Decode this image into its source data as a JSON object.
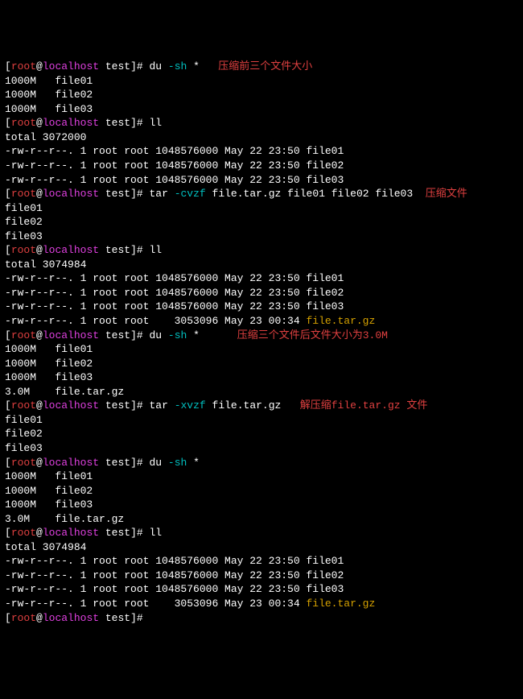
{
  "prompt": {
    "open": "[",
    "user": "root",
    "at": "@",
    "host": "localhost",
    "space": " ",
    "dir": "test",
    "close": "]# "
  },
  "lines": [
    {
      "type": "prompt",
      "cmd": "du ",
      "arg": "-sh",
      "tail": " *",
      "comment": "   压缩前三个文件大小"
    },
    {
      "type": "plain",
      "text": "1000M   file01"
    },
    {
      "type": "plain",
      "text": "1000M   file02"
    },
    {
      "type": "plain",
      "text": "1000M   file03"
    },
    {
      "type": "prompt",
      "cmd": "ll",
      "arg": "",
      "tail": "",
      "comment": ""
    },
    {
      "type": "plain",
      "text": "total 3072000"
    },
    {
      "type": "plain",
      "text": "-rw-r--r--. 1 root root 1048576000 May 22 23:50 file01"
    },
    {
      "type": "plain",
      "text": "-rw-r--r--. 1 root root 1048576000 May 22 23:50 file02"
    },
    {
      "type": "plain",
      "text": "-rw-r--r--. 1 root root 1048576000 May 22 23:50 file03"
    },
    {
      "type": "prompt",
      "cmd": "tar ",
      "arg": "-cvzf",
      "tail": " file.tar.gz file01 file02 file03",
      "comment": "  压缩文件"
    },
    {
      "type": "plain",
      "text": "file01"
    },
    {
      "type": "plain",
      "text": "file02"
    },
    {
      "type": "plain",
      "text": "file03"
    },
    {
      "type": "prompt",
      "cmd": "ll",
      "arg": "",
      "tail": "",
      "comment": ""
    },
    {
      "type": "plain",
      "text": "total 3074984"
    },
    {
      "type": "plain",
      "text": "-rw-r--r--. 1 root root 1048576000 May 22 23:50 file01"
    },
    {
      "type": "plain",
      "text": "-rw-r--r--. 1 root root 1048576000 May 22 23:50 file02"
    },
    {
      "type": "plain",
      "text": "-rw-r--r--. 1 root root 1048576000 May 22 23:50 file03"
    },
    {
      "type": "ls-gold",
      "pre": "-rw-r--r--. 1 root root    3053096 May 23 00:34 ",
      "gold": "file.tar.gz"
    },
    {
      "type": "prompt",
      "cmd": "du ",
      "arg": "-sh",
      "tail": " *",
      "comment": "      压缩三个文件后文件大小为3.0M"
    },
    {
      "type": "plain",
      "text": "1000M   file01"
    },
    {
      "type": "plain",
      "text": "1000M   file02"
    },
    {
      "type": "plain",
      "text": "1000M   file03"
    },
    {
      "type": "plain",
      "text": "3.0M    file.tar.gz"
    },
    {
      "type": "prompt",
      "cmd": "tar ",
      "arg": "-xvzf",
      "tail": " file.tar.gz",
      "comment": "   解压缩file.tar.gz 文件"
    },
    {
      "type": "plain",
      "text": "file01"
    },
    {
      "type": "plain",
      "text": "file02"
    },
    {
      "type": "plain",
      "text": "file03"
    },
    {
      "type": "prompt",
      "cmd": "du ",
      "arg": "-sh",
      "tail": " *",
      "comment": ""
    },
    {
      "type": "plain",
      "text": "1000M   file01"
    },
    {
      "type": "plain",
      "text": "1000M   file02"
    },
    {
      "type": "plain",
      "text": "1000M   file03"
    },
    {
      "type": "plain",
      "text": "3.0M    file.tar.gz"
    },
    {
      "type": "prompt",
      "cmd": "ll",
      "arg": "",
      "tail": "",
      "comment": ""
    },
    {
      "type": "plain",
      "text": "total 3074984"
    },
    {
      "type": "plain",
      "text": "-rw-r--r--. 1 root root 1048576000 May 22 23:50 file01"
    },
    {
      "type": "plain",
      "text": "-rw-r--r--. 1 root root 1048576000 May 22 23:50 file02"
    },
    {
      "type": "plain",
      "text": "-rw-r--r--. 1 root root 1048576000 May 22 23:50 file03"
    },
    {
      "type": "ls-gold",
      "pre": "-rw-r--r--. 1 root root    3053096 May 23 00:34 ",
      "gold": "file.tar.gz"
    },
    {
      "type": "prompt",
      "cmd": "",
      "arg": "",
      "tail": "",
      "comment": ""
    }
  ]
}
